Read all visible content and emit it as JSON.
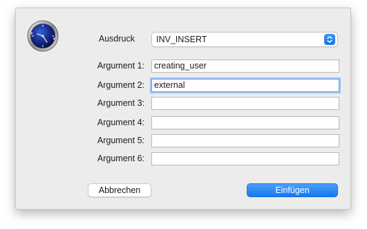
{
  "dialog": {
    "expression_label": "Ausdruck",
    "expression_value": "INV_INSERT",
    "arguments": [
      {
        "label": "Argument 1:",
        "value": "creating_user"
      },
      {
        "label": "Argument 2:",
        "value": "external"
      },
      {
        "label": "Argument 3:",
        "value": ""
      },
      {
        "label": "Argument 4:",
        "value": ""
      },
      {
        "label": "Argument 5:",
        "value": ""
      },
      {
        "label": "Argument 6:",
        "value": ""
      }
    ],
    "cancel_label": "Abbrechen",
    "insert_label": "Einfügen",
    "focused_field": "Argument 2:",
    "accent_color": "#1a73e8",
    "icon": "clock-icon"
  }
}
